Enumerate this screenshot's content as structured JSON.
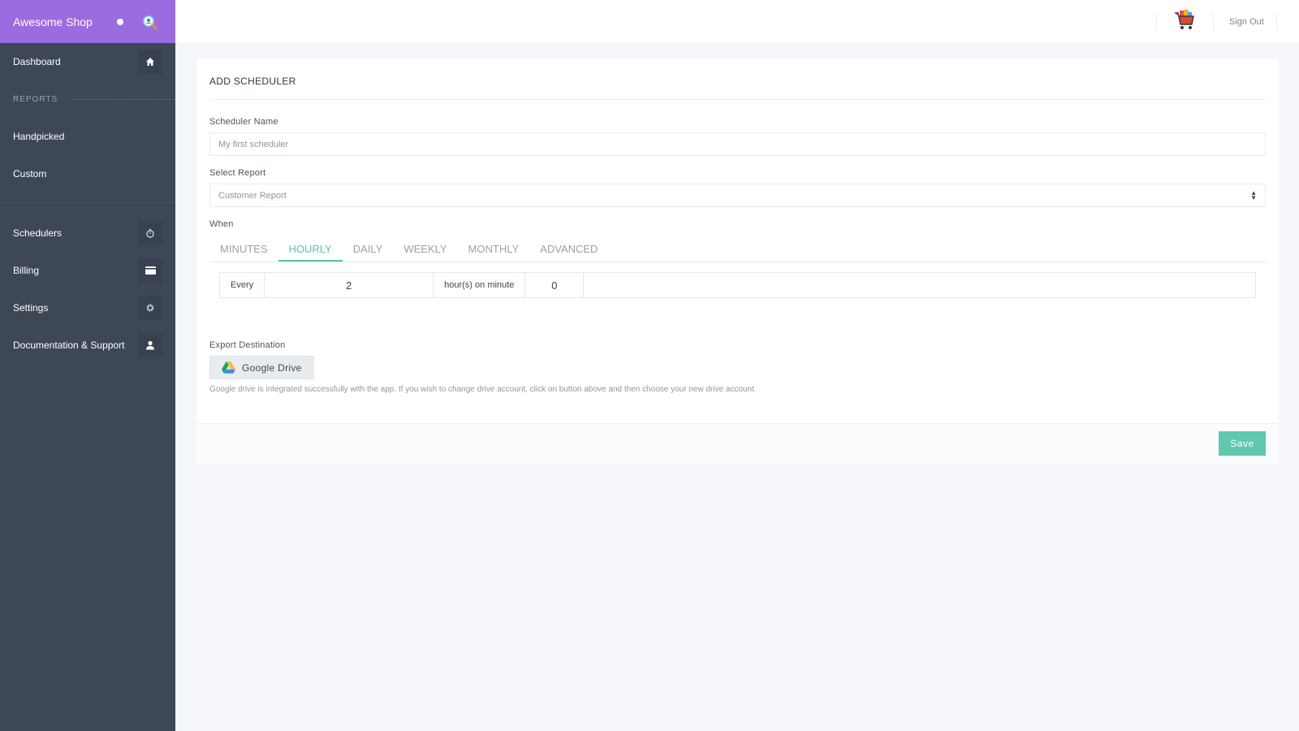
{
  "brand": {
    "name": "Awesome Shop"
  },
  "sidebar": {
    "dashboard": {
      "label": "Dashboard",
      "icon": "home-icon"
    },
    "reports_section": "REPORTS",
    "reports": [
      {
        "label": "Handpicked"
      },
      {
        "label": "Custom"
      }
    ],
    "items": [
      {
        "label": "Schedulers",
        "icon": "stopwatch-icon"
      },
      {
        "label": "Billing",
        "icon": "credit-card-icon"
      },
      {
        "label": "Settings",
        "icon": "gear-icon"
      },
      {
        "label": "Documentation & Support",
        "icon": "user-icon"
      }
    ]
  },
  "topbar": {
    "signout_label": "Sign Out"
  },
  "form": {
    "title": "ADD SCHEDULER",
    "scheduler_name_label": "Scheduler Name",
    "scheduler_name_placeholder": "My first scheduler",
    "select_report_label": "Select Report",
    "select_report_value": "Customer Report",
    "when_label": "When",
    "tabs": [
      "MINUTES",
      "HOURLY",
      "DAILY",
      "WEEKLY",
      "MONTHLY",
      "ADVANCED"
    ],
    "active_tab": "HOURLY",
    "hourly": {
      "every_label": "Every",
      "hours_value": "2",
      "on_minute_label": "hour(s) on minute",
      "minute_value": "0"
    },
    "export_label": "Export Destination",
    "gdrive_label": "Google Drive",
    "help_text": "Google drive is integrated successfully with the app. If you wish to change drive account, click on button above and then choose your new drive account",
    "save_label": "Save"
  },
  "colors": {
    "brand": "#9b6ce0",
    "sidebar": "#3d4755",
    "accent": "#59c4a8",
    "save_button": "#5fc8ae"
  }
}
